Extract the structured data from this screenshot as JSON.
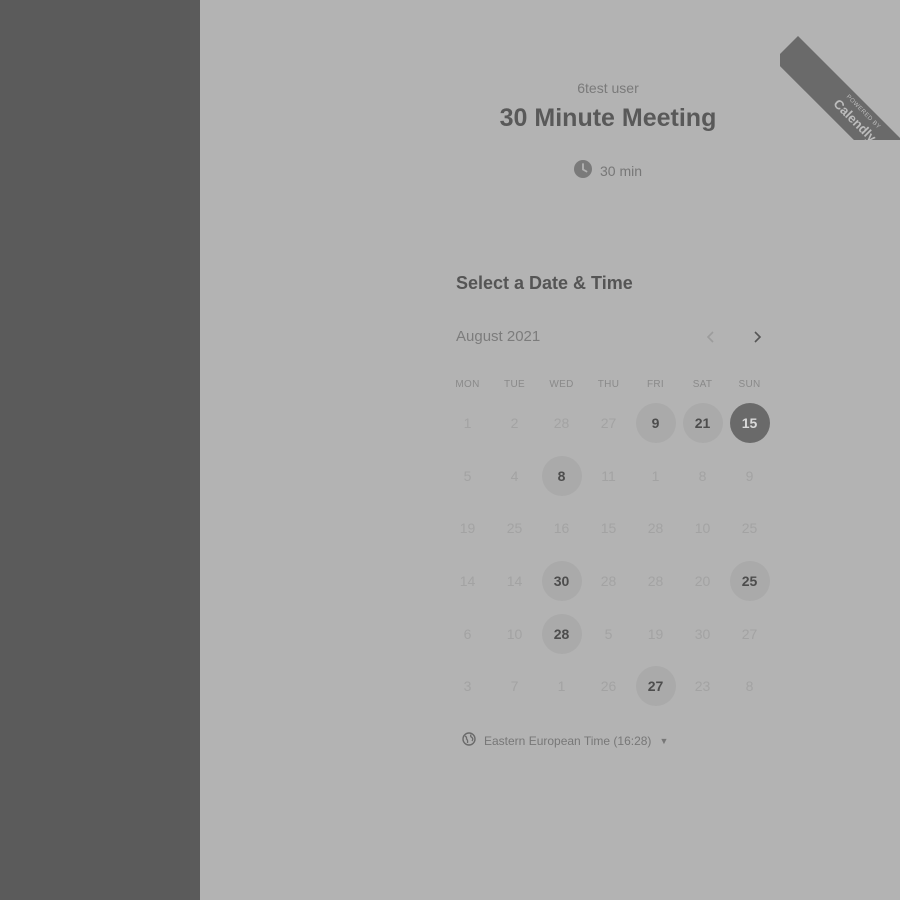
{
  "ribbon": {
    "powered": "POWERED BY",
    "brand": "Calendly"
  },
  "header": {
    "user_name": "6test user",
    "event_title": "30 Minute Meeting",
    "duration": "30 min"
  },
  "calendar": {
    "section_title": "Select a Date & Time",
    "month_label": "August 2021",
    "prev_icon": "chevron-left-icon",
    "next_icon": "chevron-right-icon",
    "weekdays": [
      "MON",
      "TUE",
      "WED",
      "THU",
      "FRI",
      "SAT",
      "SUN"
    ],
    "days": [
      {
        "label": "1",
        "state": "off"
      },
      {
        "label": "2",
        "state": "off"
      },
      {
        "label": "28",
        "state": "off"
      },
      {
        "label": "27",
        "state": "off"
      },
      {
        "label": "9",
        "state": "avail"
      },
      {
        "label": "21",
        "state": "avail"
      },
      {
        "label": "15",
        "state": "selected"
      },
      {
        "label": "5",
        "state": "off"
      },
      {
        "label": "4",
        "state": "off"
      },
      {
        "label": "8",
        "state": "avail"
      },
      {
        "label": "11",
        "state": "off"
      },
      {
        "label": "1",
        "state": "off"
      },
      {
        "label": "8",
        "state": "off"
      },
      {
        "label": "9",
        "state": "off"
      },
      {
        "label": "19",
        "state": "off"
      },
      {
        "label": "25",
        "state": "off"
      },
      {
        "label": "16",
        "state": "off"
      },
      {
        "label": "15",
        "state": "off"
      },
      {
        "label": "28",
        "state": "off"
      },
      {
        "label": "10",
        "state": "off"
      },
      {
        "label": "25",
        "state": "off"
      },
      {
        "label": "14",
        "state": "off"
      },
      {
        "label": "14",
        "state": "off"
      },
      {
        "label": "30",
        "state": "avail"
      },
      {
        "label": "28",
        "state": "off"
      },
      {
        "label": "28",
        "state": "off"
      },
      {
        "label": "20",
        "state": "off"
      },
      {
        "label": "25",
        "state": "avail"
      },
      {
        "label": "6",
        "state": "off"
      },
      {
        "label": "10",
        "state": "off"
      },
      {
        "label": "28",
        "state": "avail"
      },
      {
        "label": "5",
        "state": "off"
      },
      {
        "label": "19",
        "state": "off"
      },
      {
        "label": "30",
        "state": "off"
      },
      {
        "label": "27",
        "state": "off"
      },
      {
        "label": "3",
        "state": "off"
      },
      {
        "label": "7",
        "state": "off"
      },
      {
        "label": "1",
        "state": "off"
      },
      {
        "label": "26",
        "state": "off"
      },
      {
        "label": "27",
        "state": "avail"
      },
      {
        "label": "23",
        "state": "off"
      },
      {
        "label": "8",
        "state": "off"
      }
    ]
  },
  "timezone": {
    "icon": "globe-icon",
    "label": "Eastern European Time (16:28)"
  }
}
